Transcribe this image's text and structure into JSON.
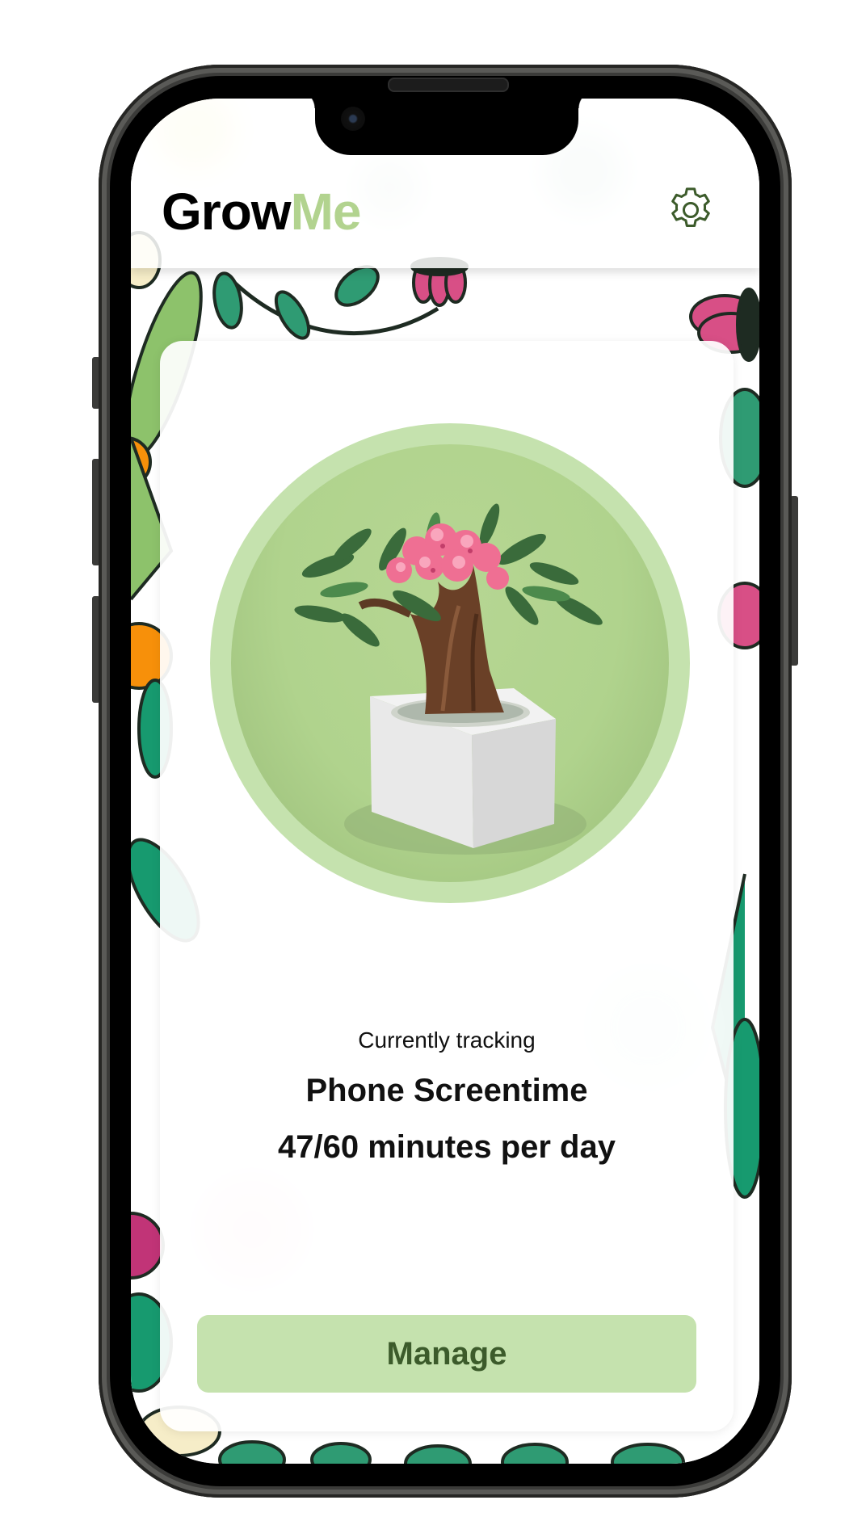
{
  "app": {
    "name_part1": "Grow",
    "name_part2": "Me",
    "brand_color_dark": "#000000",
    "brand_color_accent": "#b2d38f"
  },
  "header": {
    "settings_icon": "gear-icon"
  },
  "tracker": {
    "label": "Currently tracking",
    "habit": "Phone Screentime",
    "progress_text": "47/60 minutes per day",
    "progress_value": 47,
    "progress_max": 60
  },
  "actions": {
    "manage_label": "Manage"
  },
  "colors": {
    "accent_light": "#c5e2ae",
    "accent_text": "#3c5b2b",
    "plant_bg": "#b0d38d"
  }
}
